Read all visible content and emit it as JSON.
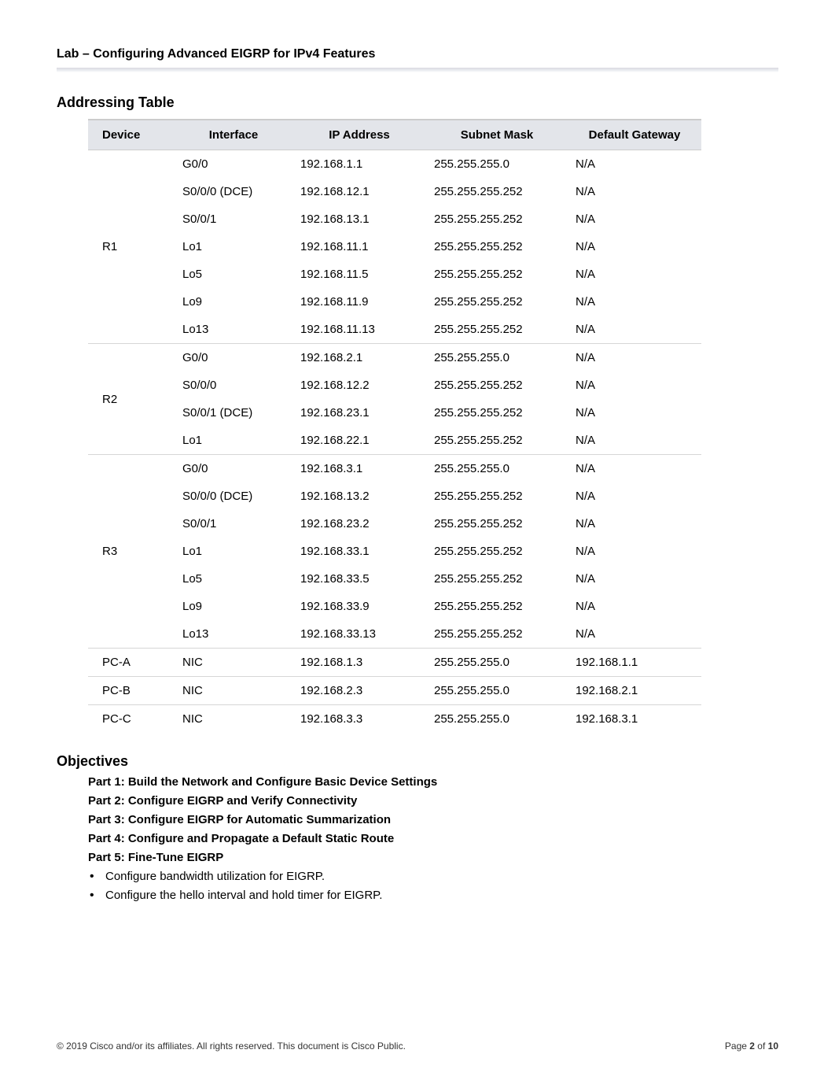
{
  "header": {
    "lab_title": "Lab – Configuring Advanced EIGRP for IPv4 Features"
  },
  "section_titles": {
    "addressing": "Addressing Table",
    "objectives": "Objectives"
  },
  "table": {
    "headers": [
      "Device",
      "Interface",
      "IP Address",
      "Subnet Mask",
      "Default Gateway"
    ],
    "groups": [
      {
        "device": "R1",
        "rows": [
          {
            "int": "G0/0",
            "ip": "192.168.1.1",
            "mask": "255.255.255.0",
            "gw": "N/A"
          },
          {
            "int": "S0/0/0 (DCE)",
            "ip": "192.168.12.1",
            "mask": "255.255.255.252",
            "gw": "N/A"
          },
          {
            "int": "S0/0/1",
            "ip": "192.168.13.1",
            "mask": "255.255.255.252",
            "gw": "N/A"
          },
          {
            "int": "Lo1",
            "ip": "192.168.11.1",
            "mask": "255.255.255.252",
            "gw": "N/A"
          },
          {
            "int": "Lo5",
            "ip": "192.168.11.5",
            "mask": "255.255.255.252",
            "gw": "N/A"
          },
          {
            "int": "Lo9",
            "ip": "192.168.11.9",
            "mask": "255.255.255.252",
            "gw": "N/A"
          },
          {
            "int": "Lo13",
            "ip": "192.168.11.13",
            "mask": "255.255.255.252",
            "gw": "N/A"
          }
        ]
      },
      {
        "device": "R2",
        "rows": [
          {
            "int": "G0/0",
            "ip": "192.168.2.1",
            "mask": "255.255.255.0",
            "gw": "N/A"
          },
          {
            "int": "S0/0/0",
            "ip": "192.168.12.2",
            "mask": "255.255.255.252",
            "gw": "N/A"
          },
          {
            "int": "S0/0/1 (DCE)",
            "ip": "192.168.23.1",
            "mask": "255.255.255.252",
            "gw": "N/A"
          },
          {
            "int": "Lo1",
            "ip": "192.168.22.1",
            "mask": "255.255.255.252",
            "gw": "N/A"
          }
        ]
      },
      {
        "device": "R3",
        "rows": [
          {
            "int": "G0/0",
            "ip": "192.168.3.1",
            "mask": "255.255.255.0",
            "gw": "N/A"
          },
          {
            "int": "S0/0/0 (DCE)",
            "ip": "192.168.13.2",
            "mask": "255.255.255.252",
            "gw": "N/A"
          },
          {
            "int": "S0/0/1",
            "ip": "192.168.23.2",
            "mask": "255.255.255.252",
            "gw": "N/A"
          },
          {
            "int": "Lo1",
            "ip": "192.168.33.1",
            "mask": "255.255.255.252",
            "gw": "N/A"
          },
          {
            "int": "Lo5",
            "ip": "192.168.33.5",
            "mask": "255.255.255.252",
            "gw": "N/A"
          },
          {
            "int": "Lo9",
            "ip": "192.168.33.9",
            "mask": "255.255.255.252",
            "gw": "N/A"
          },
          {
            "int": "Lo13",
            "ip": "192.168.33.13",
            "mask": "255.255.255.252",
            "gw": "N/A"
          }
        ]
      },
      {
        "device": "PC-A",
        "rows": [
          {
            "int": "NIC",
            "ip": "192.168.1.3",
            "mask": "255.255.255.0",
            "gw": "192.168.1.1"
          }
        ]
      },
      {
        "device": "PC-B",
        "rows": [
          {
            "int": "NIC",
            "ip": "192.168.2.3",
            "mask": "255.255.255.0",
            "gw": "192.168.2.1"
          }
        ]
      },
      {
        "device": "PC-C",
        "rows": [
          {
            "int": "NIC",
            "ip": "192.168.3.3",
            "mask": "255.255.255.0",
            "gw": "192.168.3.1"
          }
        ]
      }
    ]
  },
  "objectives": {
    "parts": [
      "Part 1: Build the Network and Configure Basic Device Settings",
      "Part 2: Configure EIGRP and Verify Connectivity",
      "Part 3: Configure EIGRP for Automatic Summarization",
      "Part 4: Configure and Propagate a Default Static Route",
      "Part 5: Fine-Tune EIGRP"
    ],
    "bullets": [
      "Configure bandwidth utilization for EIGRP.",
      "Configure the hello interval and hold timer for EIGRP."
    ]
  },
  "footer": {
    "copyright": "© 2019 Cisco and/or its affiliates. All rights reserved. This document is Cisco Public.",
    "page_prefix": "Page ",
    "page_num": "2",
    "page_of": " of ",
    "page_total": "10"
  }
}
